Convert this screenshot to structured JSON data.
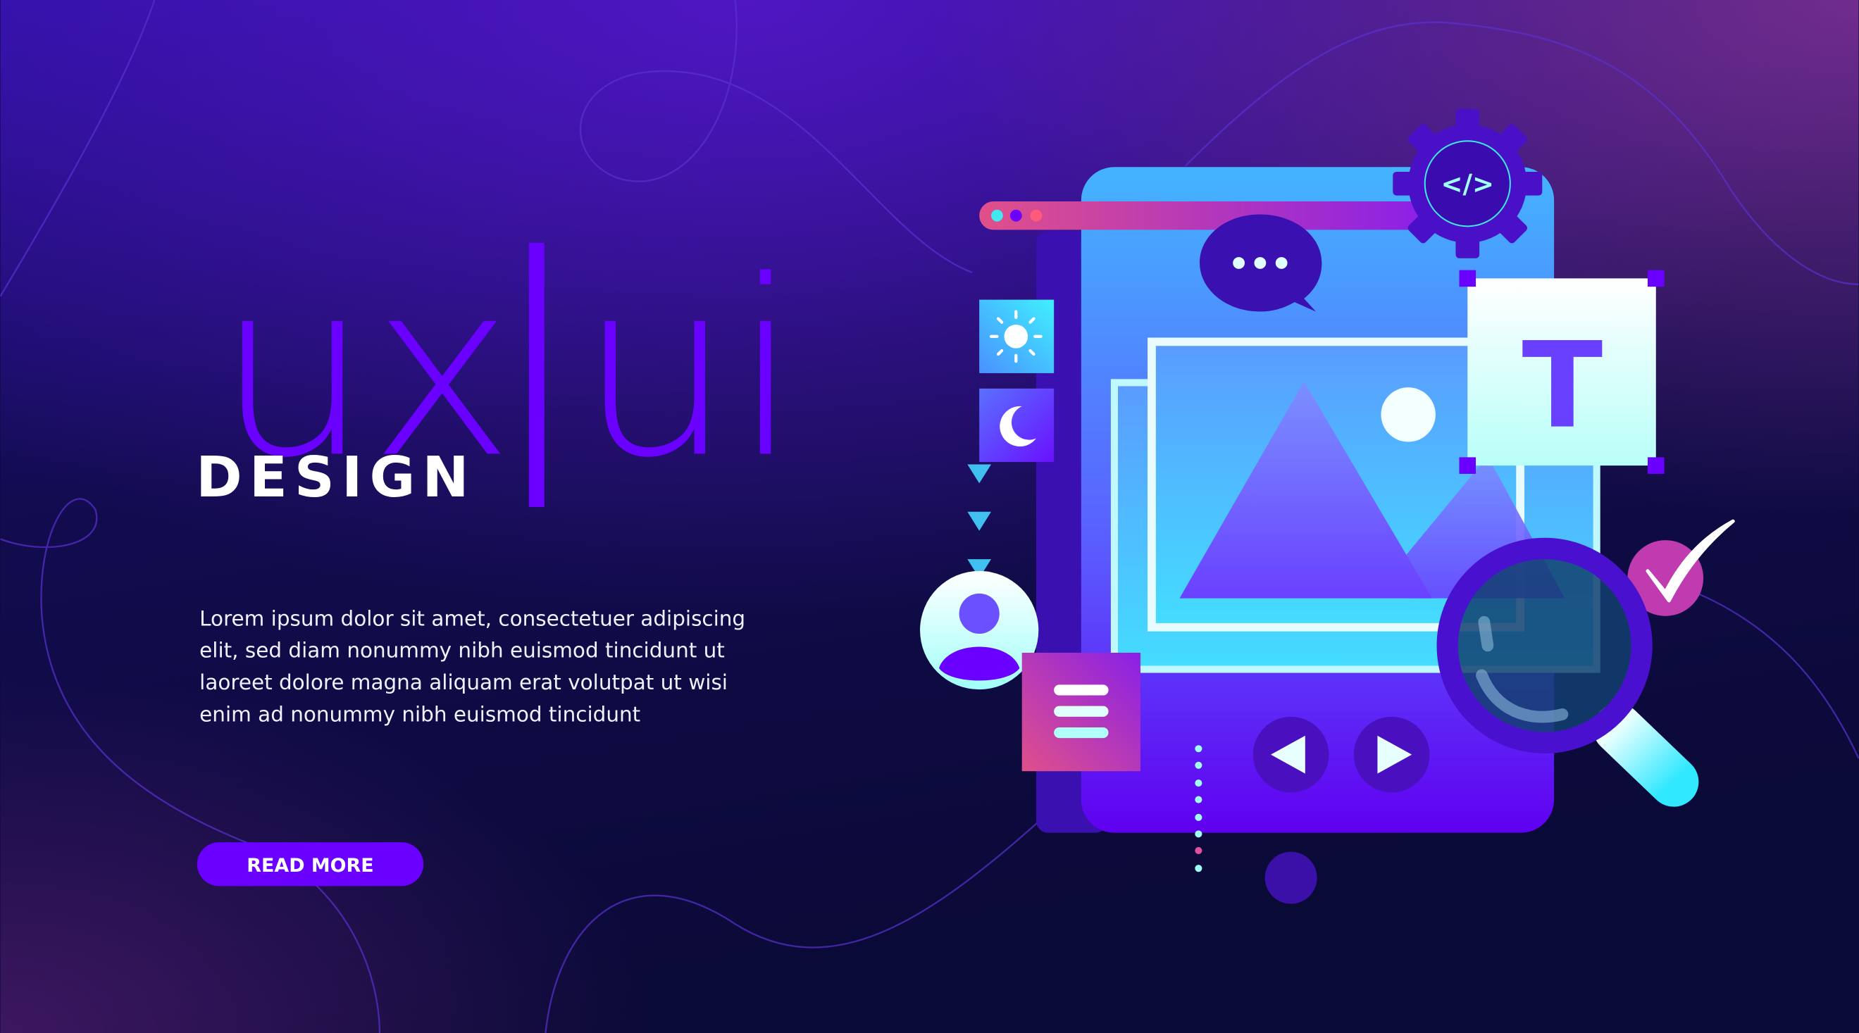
{
  "hero": {
    "title_left": "ux",
    "title_right": "ui",
    "subtitle": "DESIGN",
    "paragraph": [
      "Lorem ipsum dolor sit amet, consectetuer adipiscing",
      "elit, sed diam nonummy nibh euismod tincidunt ut",
      "laoreet dolore magna aliquam erat volutpat ut wisi",
      "enim ad nonummy nibh euismod tincidunt"
    ],
    "button_label": "READ MORE"
  },
  "illustration": {
    "code_glyph": "</>",
    "text_tool_glyph": "T",
    "icons": [
      "browser-dots-icon",
      "chat-bubble-icon",
      "gear-code-icon",
      "sun-icon",
      "moon-icon",
      "user-avatar-icon",
      "menu-icon",
      "prev-icon",
      "next-icon",
      "image-icon",
      "magnifier-icon",
      "checkmark-icon"
    ]
  },
  "colors": {
    "accent": "#6a00ff",
    "cyan": "#40e8f0",
    "pink": "#e0508a",
    "background": "#0c0a3a"
  }
}
